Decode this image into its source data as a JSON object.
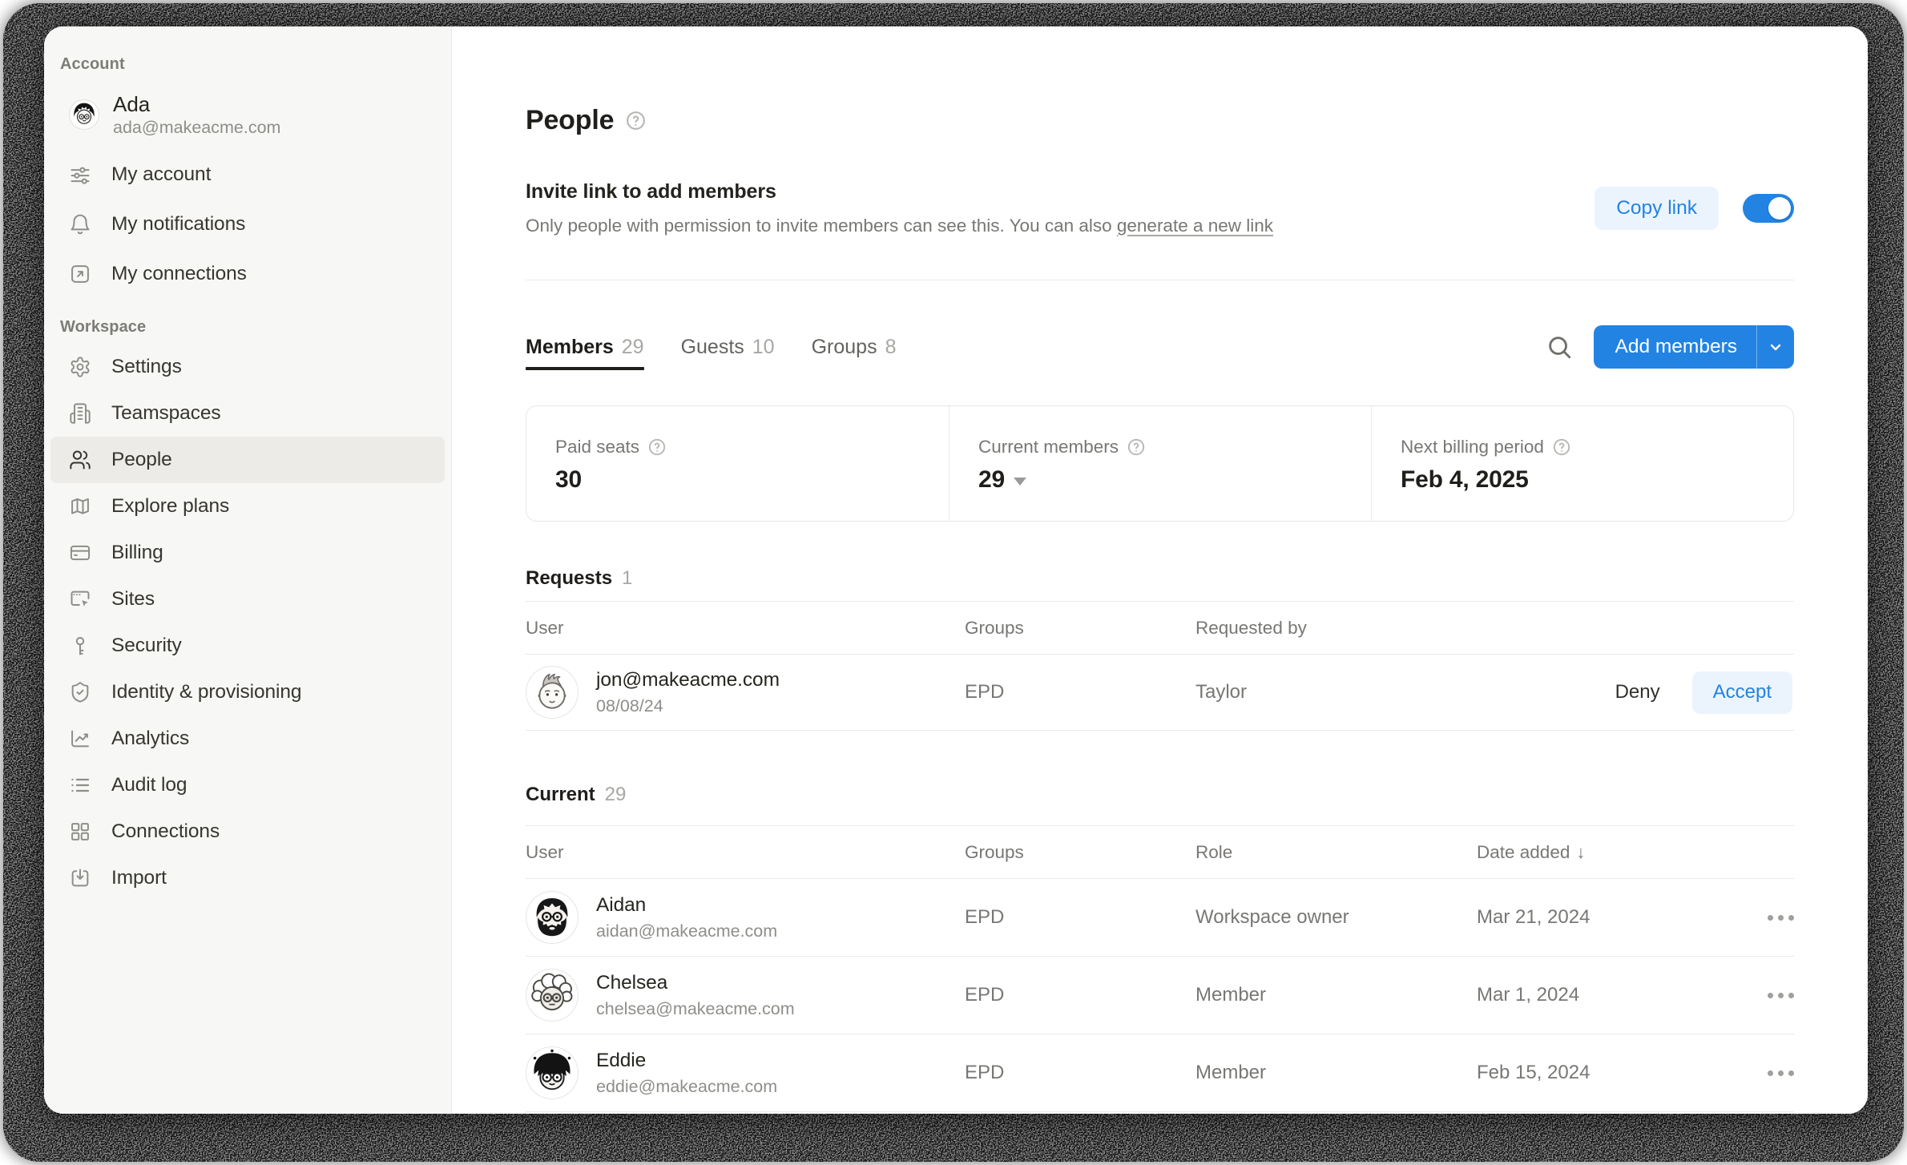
{
  "colors": {
    "accent_blue": "#2383e2",
    "accent_blue_wash": "#e9f2fc",
    "toggle_on": "#2383e2",
    "sidebar_bg": "#f7f7f5"
  },
  "sidebar": {
    "account_label": "Account",
    "user": {
      "name": "Ada",
      "email": "ada@makeacme.com",
      "avatar": "ada-avatar"
    },
    "account_items": [
      {
        "icon": "sliders-icon",
        "label": "My account"
      },
      {
        "icon": "bell-icon",
        "label": "My notifications"
      },
      {
        "icon": "arrow-up-right-box-icon",
        "label": "My connections"
      }
    ],
    "workspace_label": "Workspace",
    "workspace_items": [
      {
        "icon": "gear-icon",
        "label": "Settings"
      },
      {
        "icon": "building-icon",
        "label": "Teamspaces"
      },
      {
        "icon": "people-icon",
        "label": "People",
        "active": true
      },
      {
        "icon": "map-icon",
        "label": "Explore plans"
      },
      {
        "icon": "credit-card-icon",
        "label": "Billing"
      },
      {
        "icon": "browser-cursor-icon",
        "label": "Sites"
      },
      {
        "icon": "key-icon",
        "label": "Security"
      },
      {
        "icon": "shield-check-icon",
        "label": "Identity & provisioning"
      },
      {
        "icon": "chart-line-icon",
        "label": "Analytics"
      },
      {
        "icon": "list-icon",
        "label": "Audit log"
      },
      {
        "icon": "grid-icon",
        "label": "Connections"
      },
      {
        "icon": "import-icon",
        "label": "Import"
      }
    ]
  },
  "main": {
    "title": "People",
    "invite": {
      "heading": "Invite link to add members",
      "description": "Only people with permission to invite members can see this. You can also ",
      "link_text": "generate a new link",
      "copy_button": "Copy link",
      "toggle_state": "on"
    },
    "tabs": [
      {
        "label": "Members",
        "count": "29",
        "active": true
      },
      {
        "label": "Guests",
        "count": "10",
        "active": false
      },
      {
        "label": "Groups",
        "count": "8",
        "active": false
      }
    ],
    "add_members_button": "Add members",
    "stats": [
      {
        "label": "Paid seats",
        "value": "30"
      },
      {
        "label": "Current members",
        "value": "29",
        "has_dropdown": true
      },
      {
        "label": "Next billing period",
        "value": "Feb 4, 2025"
      }
    ],
    "requests": {
      "heading": "Requests",
      "count": "1",
      "columns": [
        "User",
        "Groups",
        "Requested by"
      ],
      "rows": [
        {
          "avatar": "jon-avatar",
          "email": "jon@makeacme.com",
          "date": "08/08/24",
          "groups": "EPD",
          "requested_by": "Taylor",
          "deny_label": "Deny",
          "accept_label": "Accept"
        }
      ]
    },
    "current": {
      "heading": "Current",
      "count": "29",
      "columns": [
        "User",
        "Groups",
        "Role",
        "Date added"
      ],
      "sort_arrow": "↓",
      "rows": [
        {
          "avatar": "aidan-avatar",
          "name": "Aidan",
          "email": "aidan@makeacme.com",
          "groups": "EPD",
          "role": "Workspace owner",
          "date_added": "Mar 21, 2024"
        },
        {
          "avatar": "chelsea-avatar",
          "name": "Chelsea",
          "email": "chelsea@makeacme.com",
          "groups": "EPD",
          "role": "Member",
          "date_added": "Mar 1, 2024"
        },
        {
          "avatar": "eddie-avatar",
          "name": "Eddie",
          "email": "eddie@makeacme.com",
          "groups": "EPD",
          "role": "Member",
          "date_added": "Feb 15, 2024"
        }
      ]
    }
  }
}
